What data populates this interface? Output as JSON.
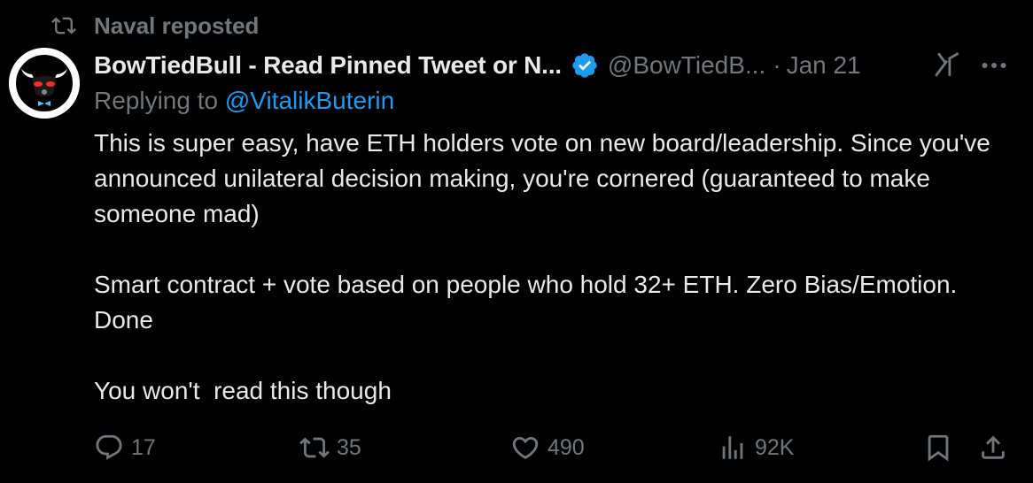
{
  "repost": {
    "label": "Naval reposted"
  },
  "author": {
    "display_name": "BowTiedBull - Read Pinned Tweet or N...",
    "handle": "@BowTiedB...",
    "separator": "·",
    "date": "Jan 21",
    "verified": true
  },
  "reply": {
    "prefix": "Replying to ",
    "mention": "@VitalikButerin"
  },
  "body": {
    "paragraph_1": "This is super easy, have ETH holders vote on new board/leadership. Since you've announced unilateral decision making, you're cornered (guaranteed to make someone mad)",
    "paragraph_2": "Smart contract + vote based on people who hold 32+ ETH. Zero Bias/Emotion. Done",
    "paragraph_3": "You won't  read this though"
  },
  "actions": {
    "replies": "17",
    "reposts": "35",
    "likes": "490",
    "views": "92K"
  },
  "colors": {
    "background": "#000000",
    "text": "#e7e9ea",
    "muted": "#71767b",
    "link": "#1d9bf0",
    "verified": "#1d9bf0"
  },
  "icons": [
    "repost-icon",
    "verified-badge-icon",
    "grok-icon",
    "more-icon",
    "reply-icon",
    "like-icon",
    "views-icon",
    "bookmark-icon",
    "share-icon"
  ]
}
